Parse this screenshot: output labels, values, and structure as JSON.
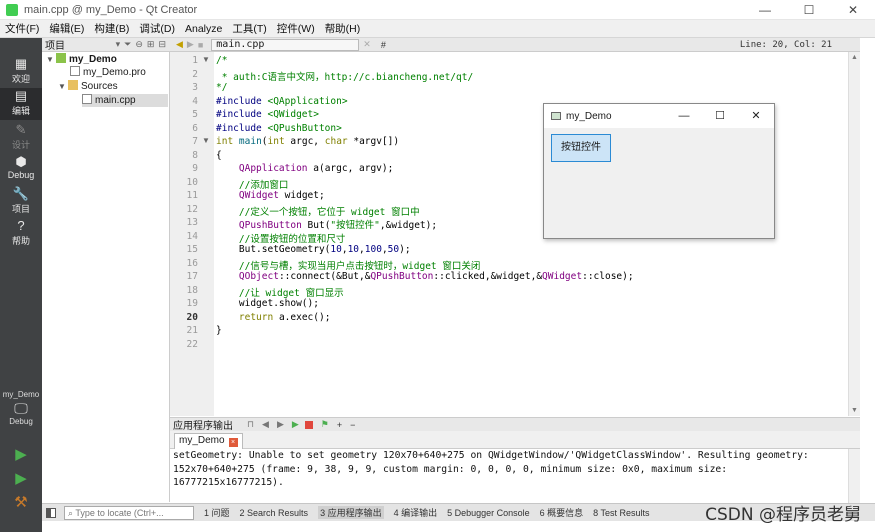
{
  "window": {
    "title": "main.cpp @ my_Demo - Qt Creator",
    "controls": [
      "—",
      "☐",
      "✕"
    ]
  },
  "menu": [
    "文件(F)",
    "编辑(E)",
    "构建(B)",
    "调试(D)",
    "Analyze",
    "工具(T)",
    "控件(W)",
    "帮助(H)"
  ],
  "modes": [
    {
      "label": "欢迎",
      "icon": "grid-icon"
    },
    {
      "label": "编辑",
      "icon": "edit-icon"
    },
    {
      "label": "设计",
      "icon": "pencil-icon"
    },
    {
      "label": "Debug",
      "icon": "bug-icon"
    },
    {
      "label": "项目",
      "icon": "wrench-icon"
    },
    {
      "label": "帮助",
      "icon": "help-icon"
    }
  ],
  "kit": {
    "name": "my_Demo",
    "mode": "Debug"
  },
  "project_pane": {
    "title": "项目",
    "tree": [
      {
        "label": "my_Demo",
        "level": 0
      },
      {
        "label": "my_Demo.pro",
        "level": 1
      },
      {
        "label": "Sources",
        "level": 1
      },
      {
        "label": "main.cpp",
        "level": 2
      }
    ]
  },
  "editor": {
    "file": "main.cpp",
    "position": "Line: 20, Col: 21",
    "hash": "#",
    "line_numbers": [
      "1",
      "2",
      "3",
      "4",
      "5",
      "6",
      "7",
      "8",
      "9",
      "10",
      "11",
      "12",
      "13",
      "14",
      "15",
      "16",
      "17",
      "18",
      "19",
      "20",
      "21",
      "22"
    ]
  },
  "code_lines": [
    [
      "/*"
    ],
    [
      " * auth:C语言中文网，http://c.biancheng.net/qt/"
    ],
    [
      "*/"
    ],
    [
      "#include ",
      "<QApplication>"
    ],
    [
      "#include ",
      "<QWidget>"
    ],
    [
      "#include ",
      "<QPushButton>"
    ],
    [
      "int",
      " ",
      "main",
      "(",
      "int",
      " argc, ",
      "char",
      " *argv[])"
    ],
    [
      "{"
    ],
    [
      "    ",
      "QApplication",
      " a(argc, argv);"
    ],
    [
      "    ",
      "//添加窗口"
    ],
    [
      "    ",
      "QWidget",
      " widget;"
    ],
    [
      "    ",
      "//定义一个按钮，它位于 widget 窗口中"
    ],
    [
      "    ",
      "QPushButton",
      " But(",
      "\"按钮控件\"",
      ",&widget);"
    ],
    [
      "    ",
      "//设置按钮的位置和尺寸"
    ],
    [
      "    But.setGeometry(",
      "10",
      ",",
      "10",
      ",",
      "100",
      ",",
      "50",
      ");"
    ],
    [
      "    ",
      "//信号与槽，实现当用户点击按钮时，widget 窗口关闭"
    ],
    [
      "    ",
      "QObject",
      "::connect(&But,&",
      "QPushButton",
      "::clicked,&widget,&",
      "QWidget",
      "::close);"
    ],
    [
      "    ",
      "//让 widget 窗口显示"
    ],
    [
      "    widget.show();"
    ],
    [
      "    ",
      "return",
      " a.exec();"
    ],
    [
      "}"
    ],
    [
      ""
    ]
  ],
  "demo_window": {
    "title": "my_Demo",
    "button": "按钮控件"
  },
  "output": {
    "pane_title": "应用程序输出",
    "tab": "my_Demo",
    "lines": [
      "setGeometry: Unable to set geometry 120x70+640+275 on QWidgetWindow/'QWidgetClassWindow'. Resulting geometry:",
      "152x70+640+275 (frame: 9, 38, 9, 9, custom margin: 0, 0, 0, 0, minimum size: 0x0, maximum size:",
      "16777215x16777215)."
    ]
  },
  "statusbar": {
    "locator_placeholder": "Type to locate (Ctrl+...",
    "items": [
      "1 问题",
      "2 Search Results",
      "3 应用程序输出",
      "4 编译输出",
      "5 Debugger Console",
      "6 概要信息",
      "8 Test Results"
    ],
    "watermark": "CSDN @程序员老舅"
  }
}
